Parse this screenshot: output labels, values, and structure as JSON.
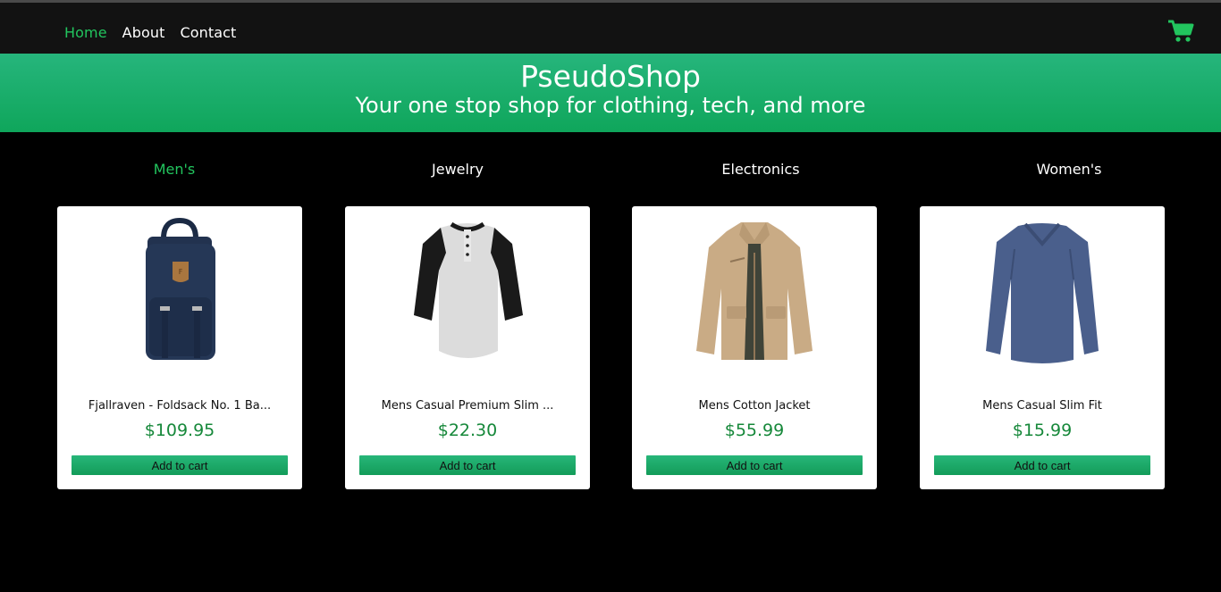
{
  "nav": {
    "links": [
      "Home",
      "About",
      "Contact"
    ],
    "active": "Home",
    "cart_icon": "cart-icon",
    "accent": "#22c55e"
  },
  "hero": {
    "title": "PseudoShop",
    "subtitle": "Your one stop shop for clothing, tech, and more"
  },
  "categories": [
    "Men's",
    "Jewelry",
    "Electronics",
    "Women's"
  ],
  "active_category": "Men's",
  "products": [
    {
      "title": "Fjallraven - Foldsack No. 1 Ba...",
      "price": "$109.95",
      "button": "Add to cart",
      "image": "backpack-image"
    },
    {
      "title": "Mens Casual Premium Slim ...",
      "price": "$22.30",
      "button": "Add to cart",
      "image": "raglan-shirt-image"
    },
    {
      "title": "Mens Cotton Jacket",
      "price": "$55.99",
      "button": "Add to cart",
      "image": "jacket-image"
    },
    {
      "title": "Mens Casual Slim Fit",
      "price": "$15.99",
      "button": "Add to cart",
      "image": "long-sleeve-tee-image"
    }
  ]
}
